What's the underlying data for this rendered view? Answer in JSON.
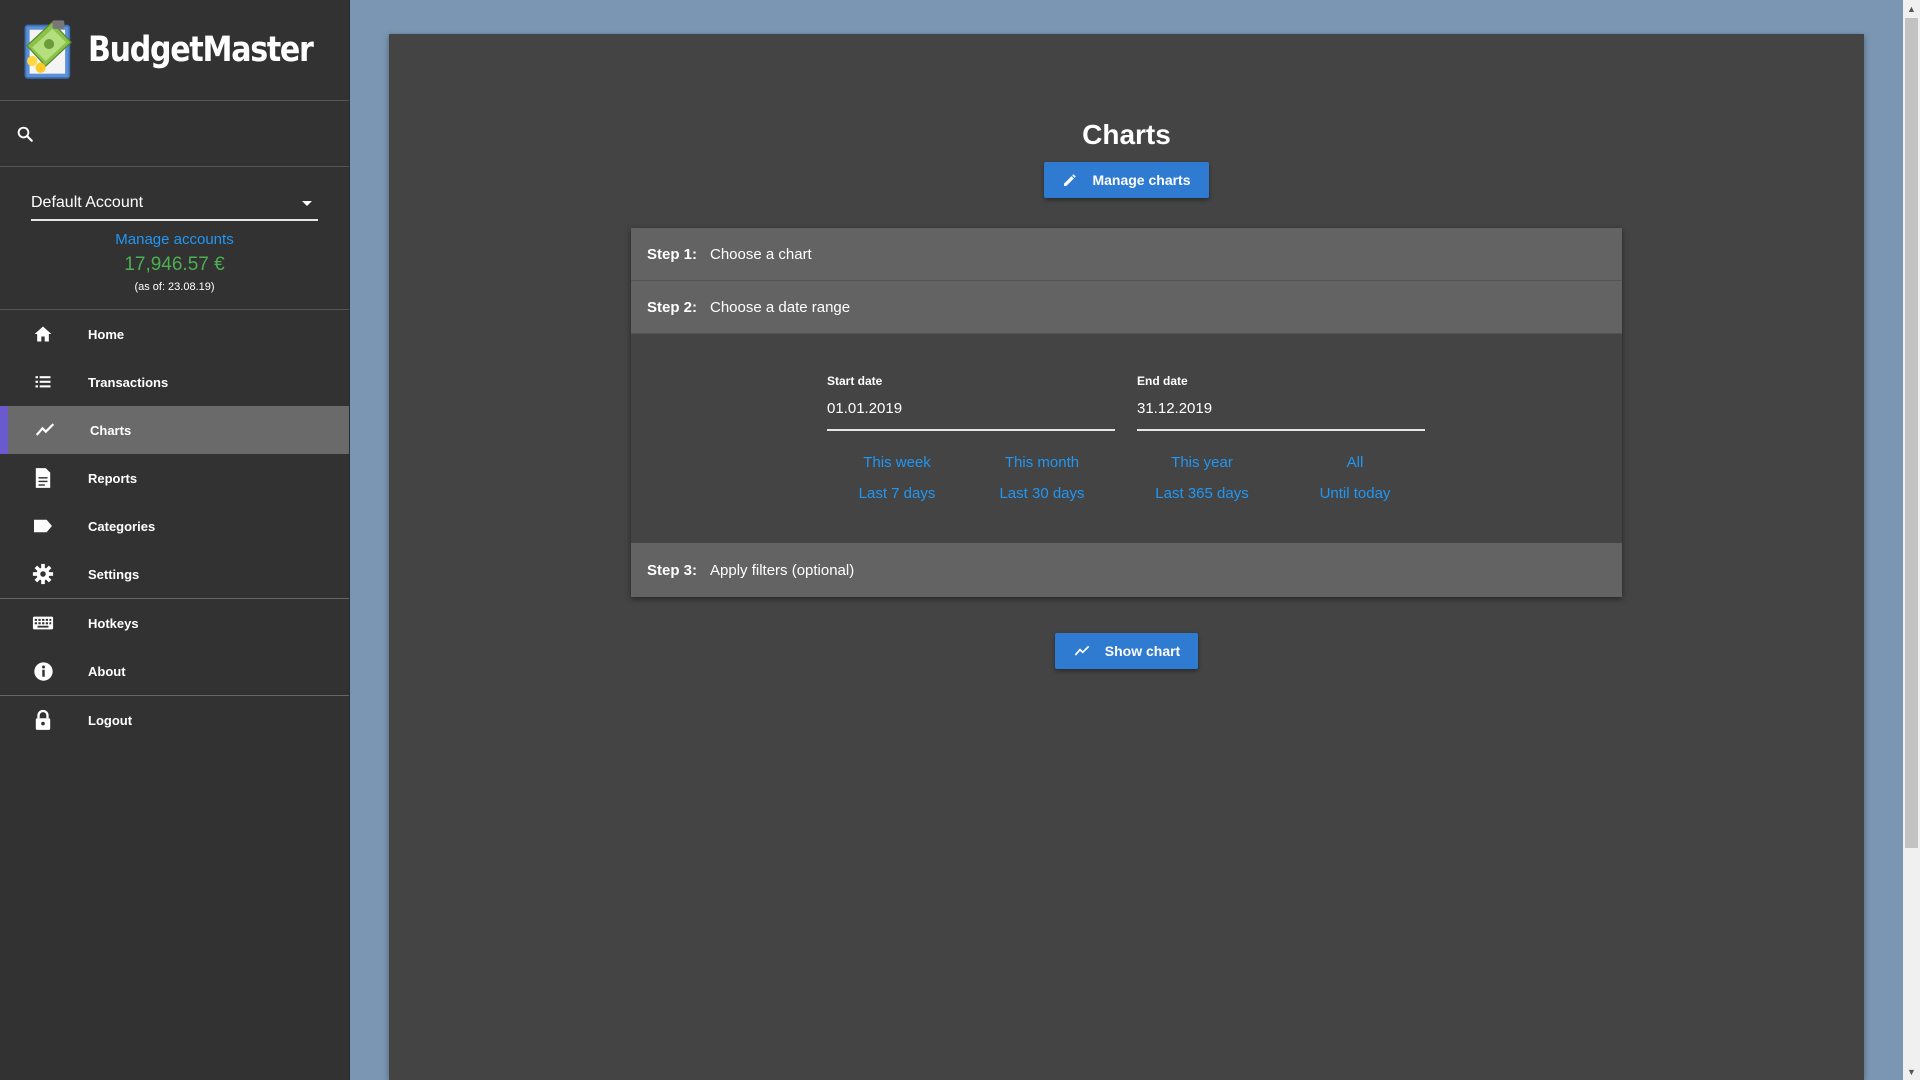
{
  "app": {
    "name": "BudgetMaster"
  },
  "sidebar": {
    "search_placeholder": "",
    "account": {
      "selected": "Default Account",
      "manage_label": "Manage accounts",
      "balance": "17,946.57 €",
      "balance_date": "(as of: 23.08.19)"
    },
    "nav": [
      {
        "label": "Home",
        "icon": "home-icon"
      },
      {
        "label": "Transactions",
        "icon": "list-icon"
      },
      {
        "label": "Charts",
        "icon": "chart-line-icon",
        "active": true
      },
      {
        "label": "Reports",
        "icon": "document-icon"
      },
      {
        "label": "Categories",
        "icon": "tag-icon"
      },
      {
        "label": "Settings",
        "icon": "gear-icon"
      },
      {
        "label": "Hotkeys",
        "icon": "keyboard-icon"
      },
      {
        "label": "About",
        "icon": "info-icon"
      },
      {
        "label": "Logout",
        "icon": "lock-icon"
      }
    ]
  },
  "main": {
    "title": "Charts",
    "manage_button": "Manage charts",
    "steps": [
      {
        "number": "Step 1:",
        "title": "Choose a chart"
      },
      {
        "number": "Step 2:",
        "title": "Choose a date range"
      },
      {
        "number": "Step 3:",
        "title": "Apply filters (optional)"
      }
    ],
    "date_range": {
      "start_label": "Start date",
      "start_value": "01.01.2019",
      "end_label": "End date",
      "end_value": "31.12.2019",
      "quick_links_row1": [
        "This week",
        "This month",
        "This year",
        "All"
      ],
      "quick_links_row2": [
        "Last 7 days",
        "Last 30 days",
        "Last 365 days",
        "Until today"
      ]
    },
    "show_button": "Show chart"
  },
  "colors": {
    "accent": "#2e7bd1",
    "link": "#2196f3",
    "balance": "#4caf50",
    "active_marker": "#6a5acd",
    "sidebar_bg": "#323232",
    "page_bg": "#7a96b2"
  }
}
